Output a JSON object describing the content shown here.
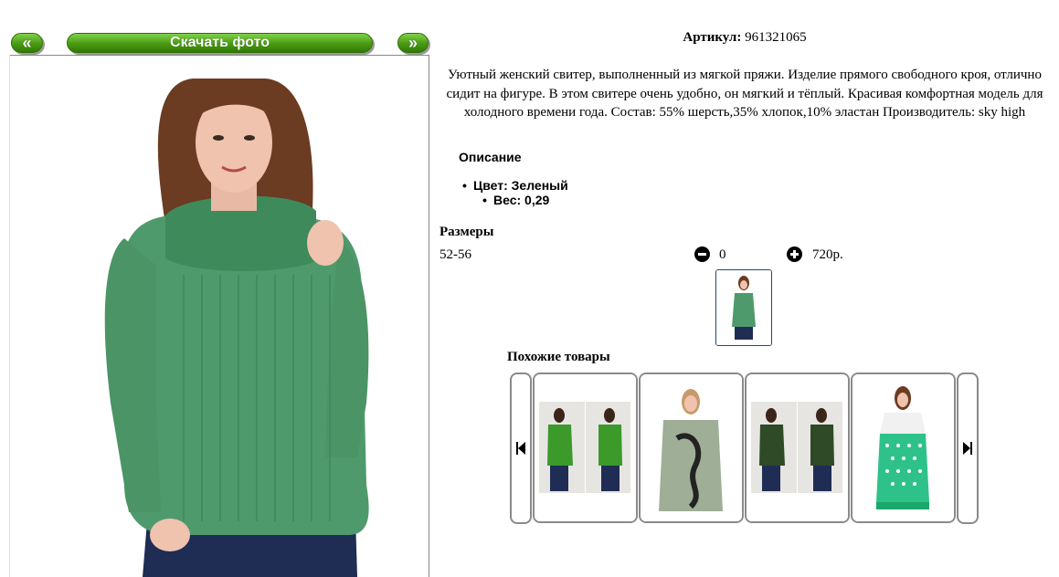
{
  "nav": {
    "prev_label": "«",
    "download_label": "Скачать фото",
    "next_label": "»"
  },
  "product": {
    "sku_label": "Артикул:",
    "sku_value": "961321065",
    "description": "Уютный женский свитер, выполненный из мягкой пряжи. Изделие прямого свободного кроя, отлично сидит на фигуре. В этом свитере очень удобно, он мягкий и тёплый. Красивая комфортная модель для холодного времени года. Состав: 55% шерсть,35% хлопок,10% эластан Производитель: sky high",
    "description_title": "Описание",
    "color": "Цвет: Зеленый",
    "weight": "Вес: 0,29",
    "main_color": "#4f9a6c"
  },
  "sizes": {
    "title": "Размеры",
    "rows": [
      {
        "size": "52-56",
        "qty": "0",
        "price": "720р."
      }
    ]
  },
  "similar": {
    "title": "Похожие товары",
    "items": [
      {
        "icon": "green-sweater-duo-photo"
      },
      {
        "icon": "grey-patterned-sweater-photo"
      },
      {
        "icon": "dark-green-sweater-duo-photo"
      },
      {
        "icon": "mint-polka-dot-dress-photo"
      }
    ]
  }
}
